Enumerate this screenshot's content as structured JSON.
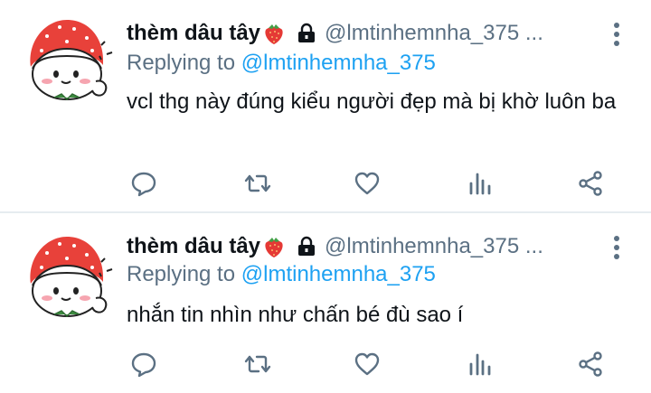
{
  "colors": {
    "name": "#0f1419",
    "muted": "#5b7083",
    "link": "#1da1f2",
    "divider": "#e6ecf0",
    "avatar_hat": "#e8413a"
  },
  "tweets": [
    {
      "author_name": "thèm dâu tây",
      "name_emoji": "strawberry-icon",
      "protected_icon": "lock-icon",
      "handle": "@lmtinhemnha_375 ...",
      "replying_prefix": "Replying to",
      "replying_handle": "@lmtinhemnha_375",
      "text": "vcl thg này đúng kiểu người đẹp mà bị khờ luôn ba",
      "actions": [
        "reply-icon",
        "retweet-icon",
        "like-icon",
        "analytics-icon",
        "share-icon"
      ]
    },
    {
      "author_name": "thèm dâu tây",
      "name_emoji": "strawberry-icon",
      "protected_icon": "lock-icon",
      "handle": "@lmtinhemnha_375 ...",
      "replying_prefix": "Replying to",
      "replying_handle": "@lmtinhemnha_375",
      "text": "nhắn tin nhìn như chấn bé đù sao í",
      "actions": [
        "reply-icon",
        "retweet-icon",
        "like-icon",
        "analytics-icon",
        "share-icon"
      ]
    }
  ]
}
